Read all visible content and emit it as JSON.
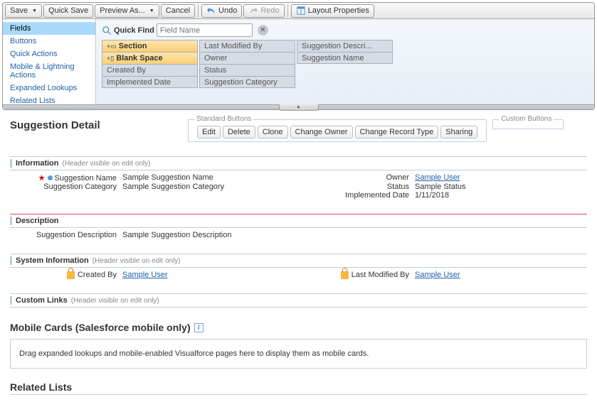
{
  "toolbar": {
    "save": "Save",
    "quick_save": "Quick Save",
    "preview_as": "Preview As...",
    "cancel": "Cancel",
    "undo": "Undo",
    "redo": "Redo",
    "layout_props": "Layout Properties"
  },
  "sidebar": {
    "items": [
      {
        "label": "Fields"
      },
      {
        "label": "Buttons"
      },
      {
        "label": "Quick Actions"
      },
      {
        "label": "Mobile & Lightning Actions"
      },
      {
        "label": "Expanded Lookups"
      },
      {
        "label": "Related Lists"
      }
    ]
  },
  "quick_find": {
    "label": "Quick Find",
    "placeholder": "Field Name"
  },
  "palette": {
    "col1": [
      {
        "label": "Section",
        "special": true
      },
      {
        "label": "Blank Space",
        "special": true
      },
      {
        "label": "Created By"
      },
      {
        "label": "Implemented Date"
      }
    ],
    "col2": [
      {
        "label": "Last Modified By"
      },
      {
        "label": "Owner"
      },
      {
        "label": "Status"
      },
      {
        "label": "Suggestion Category"
      }
    ],
    "col3": [
      {
        "label": "Suggestion Descri..."
      },
      {
        "label": "Suggestion Name"
      }
    ]
  },
  "detail": {
    "title": "Suggestion Detail",
    "standard_buttons_label": "Standard Buttons",
    "custom_buttons_label": "Custom Buttons",
    "standard_buttons": [
      "Edit",
      "Delete",
      "Clone",
      "Change Owner",
      "Change Record Type",
      "Sharing"
    ]
  },
  "sections": {
    "information": {
      "title": "Information",
      "note": "(Header visible on edit only)",
      "left": [
        {
          "label": "Suggestion Name",
          "value": "Sample Suggestion Name",
          "req": true,
          "dot": true
        },
        {
          "label": "Suggestion Category",
          "value": "Sample Suggestion Category"
        }
      ],
      "right": [
        {
          "label": "Owner",
          "value": "Sample User",
          "link": true
        },
        {
          "label": "Status",
          "value": "Sample Status"
        },
        {
          "label": "Implemented Date",
          "value": "1/11/2018"
        }
      ]
    },
    "description": {
      "title": "Description",
      "row": {
        "label": "Suggestion Description",
        "value": "Sample Suggestion Description"
      }
    },
    "system": {
      "title": "System Information",
      "note": "(Header visible on edit only)",
      "created_by_label": "Created By",
      "created_by_value": "Sample User",
      "modified_by_label": "Last Modified By",
      "modified_by_value": "Sample User"
    },
    "custom_links": {
      "title": "Custom Links",
      "note": "(Header visible on edit only)"
    }
  },
  "mobile_cards": {
    "title": "Mobile Cards (Salesforce mobile only)",
    "hint": "Drag expanded lookups and mobile-enabled Visualforce pages here to display them as mobile cards."
  },
  "related_lists": {
    "title": "Related Lists"
  }
}
